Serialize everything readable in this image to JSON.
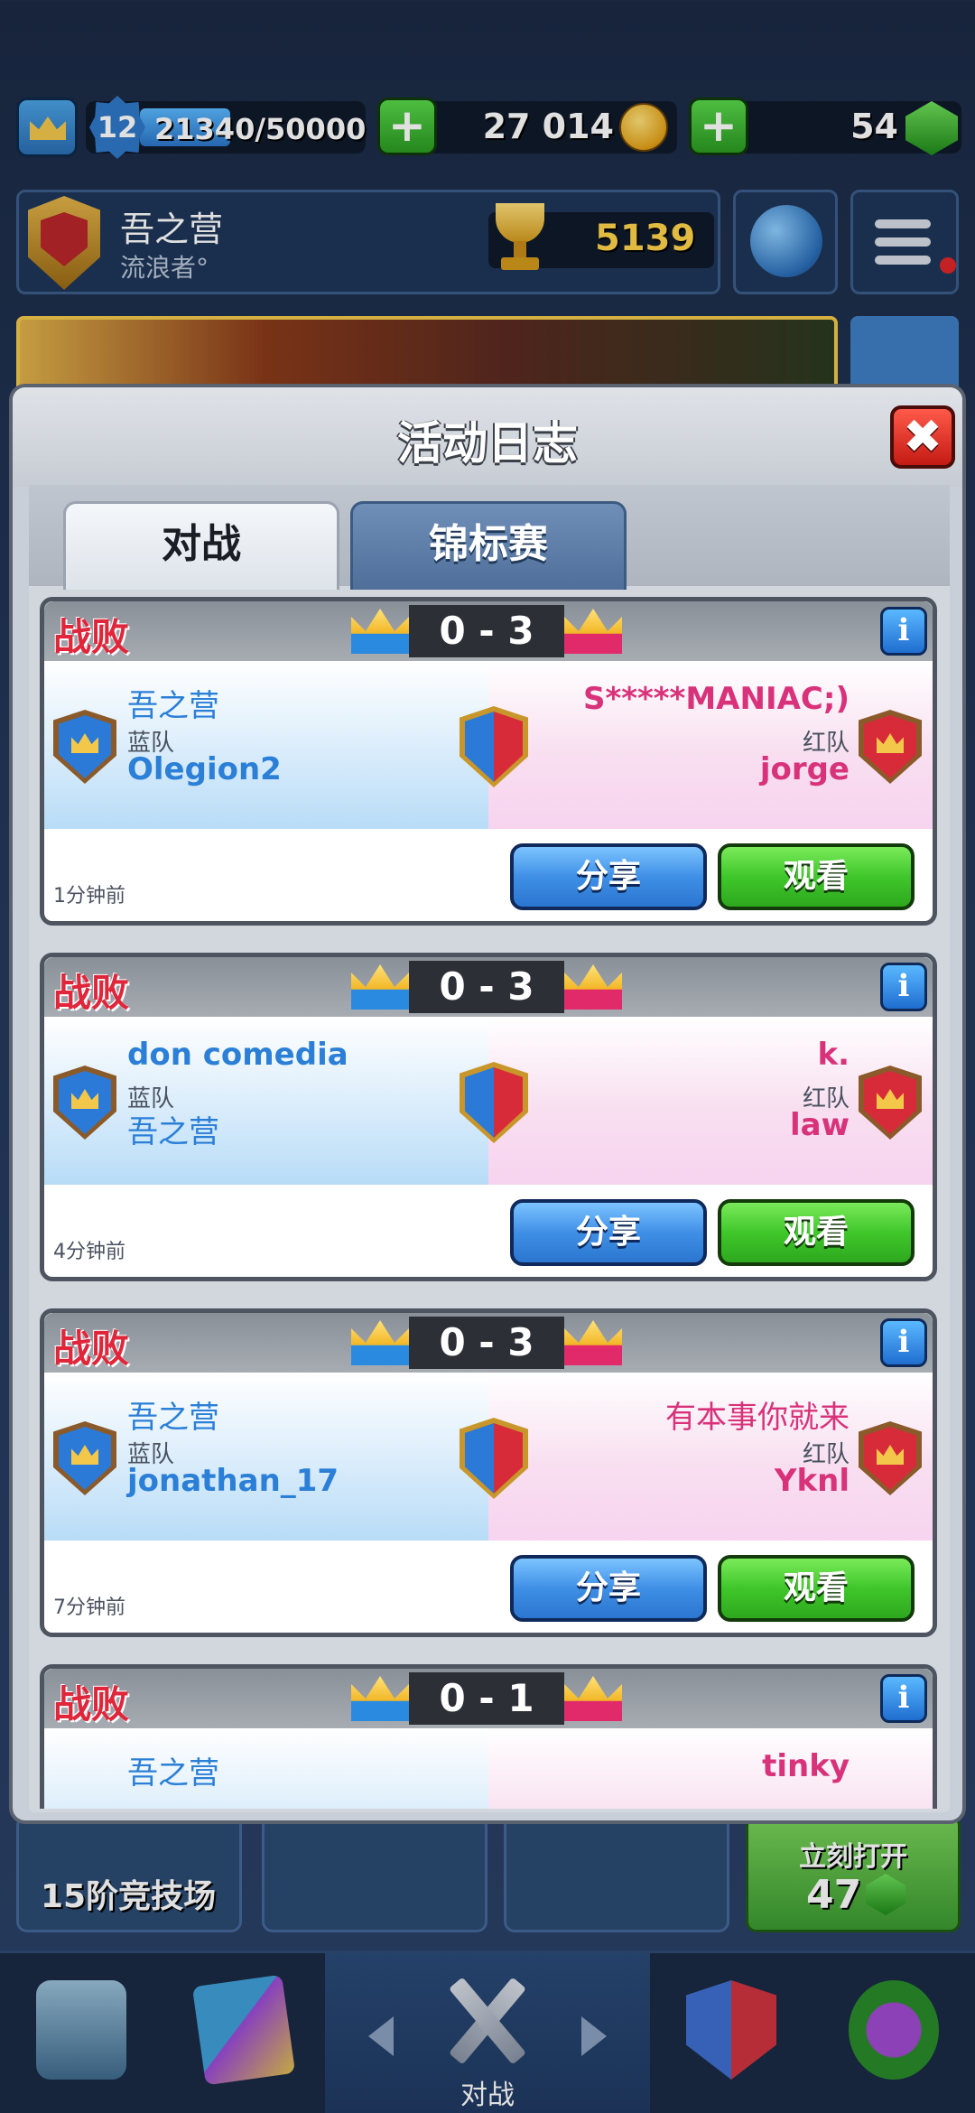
{
  "top_bar": {
    "level": "12",
    "xp": "21340/50000",
    "gold": "27 014",
    "gems": "54",
    "add_gold_label": "+",
    "add_gems_label": "+"
  },
  "player": {
    "name": "吾之营",
    "title": "流浪者°",
    "trophies": "5139"
  },
  "modal": {
    "title": "活动日志",
    "close_label": "✖",
    "tabs": [
      {
        "label": "对战",
        "active": true
      },
      {
        "label": "锦标赛",
        "active": false
      }
    ]
  },
  "battles": [
    {
      "result": "战败",
      "score": "0 - 3",
      "blue_player": "吾之营",
      "blue_team_label": "蓝队",
      "blue_teammate": "Olegion2",
      "red_player": "S*****MANIAC;)",
      "red_team_label": "红队",
      "red_teammate": "jorge",
      "time": "1分钟前",
      "share_label": "分享",
      "watch_label": "观看",
      "info_label": "i"
    },
    {
      "result": "战败",
      "score": "0 - 3",
      "blue_player": "don comedia",
      "blue_team_label": "蓝队",
      "blue_teammate": "吾之营",
      "red_player": "k.",
      "red_team_label": "红队",
      "red_teammate": "law",
      "time": "4分钟前",
      "share_label": "分享",
      "watch_label": "观看",
      "info_label": "i"
    },
    {
      "result": "战败",
      "score": "0 - 3",
      "blue_player": "吾之营",
      "blue_team_label": "蓝队",
      "blue_teammate": "jonathan_17",
      "red_player": "有本事你就来",
      "red_team_label": "红队",
      "red_teammate": "Yknl",
      "time": "7分钟前",
      "share_label": "分享",
      "watch_label": "观看",
      "info_label": "i"
    },
    {
      "result": "战败",
      "score": "0 - 1",
      "blue_player": "吾之营",
      "red_player": "tinky",
      "info_label": "i"
    }
  ],
  "background": {
    "arena_label": "15阶竞技场",
    "chest_open_label": "立刻打开",
    "chest_cost": "47"
  },
  "navbar": {
    "battle_label": "对战"
  },
  "colors": {
    "defeat_red": "#e0263a",
    "blue_team": "#2b7fd6",
    "red_team": "#d8327a",
    "share_blue": "#3f8fe6",
    "watch_green": "#3fc72a"
  }
}
